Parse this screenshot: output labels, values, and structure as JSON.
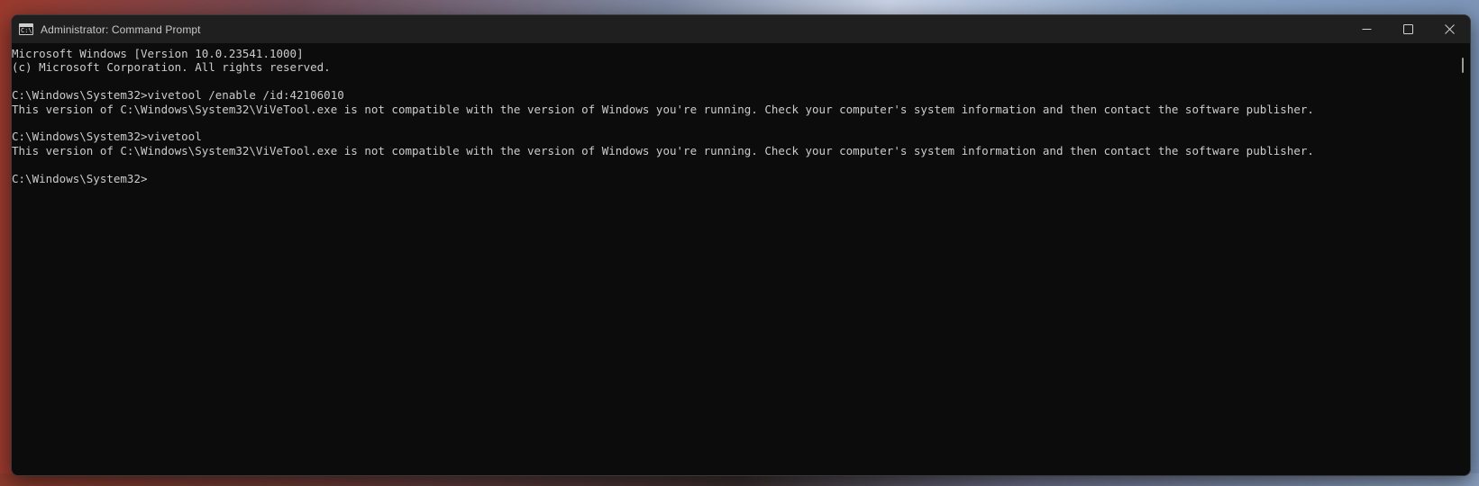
{
  "window": {
    "title": "Administrator: Command Prompt",
    "icon": "cmd-icon",
    "icon_text": "C:\\"
  },
  "controls": {
    "minimize": "minimize-icon",
    "maximize": "maximize-icon",
    "close": "close-icon"
  },
  "console": {
    "lines": [
      "Microsoft Windows [Version 10.0.23541.1000]",
      "(c) Microsoft Corporation. All rights reserved.",
      "",
      "C:\\Windows\\System32>vivetool /enable /id:42106010",
      "This version of C:\\Windows\\System32\\ViVeTool.exe is not compatible with the version of Windows you're running. Check your computer's system information and then contact the software publisher.",
      "",
      "C:\\Windows\\System32>vivetool",
      "This version of C:\\Windows\\System32\\ViVeTool.exe is not compatible with the version of Windows you're running. Check your computer's system information and then contact the software publisher.",
      "",
      "C:\\Windows\\System32>"
    ]
  },
  "colors": {
    "console_background": "#0c0c0c",
    "console_text": "#cccccc",
    "titlebar_background": "#1f1f1f"
  }
}
